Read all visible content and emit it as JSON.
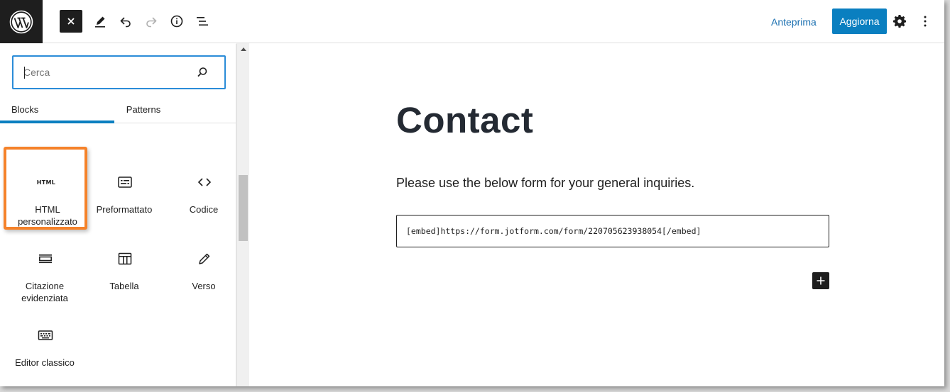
{
  "header": {
    "preview_label": "Anteprima",
    "update_label": "Aggiorna"
  },
  "inserter": {
    "search_placeholder": "Cerca",
    "tabs": [
      {
        "label": "Blocks",
        "active": true
      },
      {
        "label": "Patterns",
        "active": false
      }
    ],
    "blocks": [
      {
        "label": "HTML personalizzato",
        "icon": "html-icon",
        "highlighted": true
      },
      {
        "label": "Preformattato",
        "icon": "preformatted-icon"
      },
      {
        "label": "Codice",
        "icon": "code-icon"
      },
      {
        "label": "Citazione evidenziata",
        "icon": "pullquote-icon"
      },
      {
        "label": "Tabella",
        "icon": "table-icon"
      },
      {
        "label": "Verso",
        "icon": "verse-icon"
      },
      {
        "label": "Editor classico",
        "icon": "keyboard-icon"
      }
    ],
    "html_icon_text": "HTML"
  },
  "editor": {
    "title": "Contact",
    "paragraph": "Please use the below form for your general inquiries.",
    "embed_code": "[embed]https://form.jotform.com/form/220705623938054[/embed]"
  },
  "colors": {
    "accent": "#0a7fc0",
    "highlight": "#f5822a",
    "dark": "#1e1e1e"
  }
}
